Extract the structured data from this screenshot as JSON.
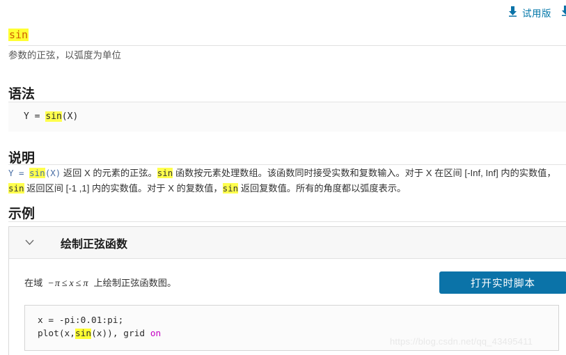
{
  "topbar": {
    "trial_label": "试用版",
    "download_icon": "download-icon",
    "edge_icon": "download-icon"
  },
  "header": {
    "function_name": "sin",
    "subtitle": "参数的正弦，以弧度为单位"
  },
  "sections": {
    "syntax": {
      "heading": "语法",
      "code_prefix": "Y = ",
      "code_fn": "sin",
      "code_suffix": "(X)"
    },
    "description": {
      "heading": "说明",
      "line1_a": "Y = ",
      "line1_fn1": "sin",
      "line1_b": "(X)",
      "line1_c": " 返回 X 的元素的正弦。",
      "line1_fn2": "sin",
      "line1_d": " 函数按元素处理数组。该函数同时接受实数和复数输入。对于 X 在区间 [-Inf, Inf] 内的实数值，",
      "line1_fn3": "sin",
      "line1_e": " 返回区间 [-1 ,1] 内的实数值。对于 X 的复数值，",
      "line1_fn4": "sin",
      "line1_f": " 返回复数值。所有的角度都以弧度表示。"
    },
    "examples": {
      "heading": "示例",
      "panel_title": "绘制正弦函数",
      "chevron": "chevron-down-icon",
      "intro_prefix": "在域",
      "math_minus_pi": "−π",
      "math_le1": "≤",
      "math_x": "x",
      "math_le2": "≤",
      "math_pi": "π",
      "intro_suffix": "上绘制正弦函数图。",
      "open_button": "打开实时脚本",
      "code_line1": "x = -pi:0.01:pi;",
      "code_line2_a": "plot(x,",
      "code_line2_fn": "sin",
      "code_line2_b": "(x)), grid ",
      "code_line2_kw": "on"
    }
  },
  "watermark": "https://blog.csdn.net/qq_43495411",
  "colors": {
    "accent_blue": "#0b73a8",
    "link_blue": "#0076a8",
    "highlight_yellow": "#ffff33",
    "title_orange": "#d05d00",
    "keyword_magenta": "#c300c3"
  }
}
